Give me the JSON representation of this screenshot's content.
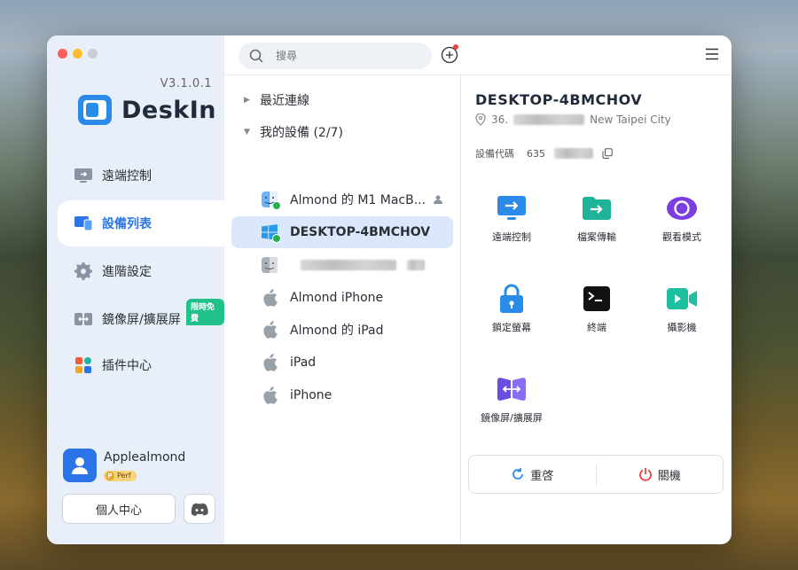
{
  "app": {
    "version": "V3.1.0.1",
    "name": "DeskIn"
  },
  "sidebar": {
    "items": [
      {
        "label": "遠端控制",
        "icon": "remote-control-icon"
      },
      {
        "label": "設備列表",
        "icon": "device-list-icon",
        "active": true
      },
      {
        "label": "進階設定",
        "icon": "gear-icon"
      },
      {
        "label": "鏡像屏/擴展屏",
        "icon": "mirror-screen-icon",
        "badge": "限時免費"
      },
      {
        "label": "插件中心",
        "icon": "plugin-grid-icon"
      }
    ],
    "user": {
      "name": "Applealmond",
      "plan_badge": "Perf",
      "plan_letter": "P"
    },
    "profile_button": "個人中心"
  },
  "topbar": {
    "search_placeholder": "搜尋"
  },
  "device_list": {
    "recent_group": "最近連線",
    "my_devices_group": "我的設備 (2/7)",
    "devices": [
      {
        "name": "Almond 的 M1 MacB...",
        "os": "mac-finder",
        "online": true
      },
      {
        "name": "DESKTOP-4BMCHOV",
        "os": "windows",
        "online": true,
        "selected": true
      },
      {
        "name": "",
        "os": "mac-finder",
        "online": false
      },
      {
        "name": "Almond iPhone",
        "os": "apple"
      },
      {
        "name": "Almond 的 iPad",
        "os": "apple"
      },
      {
        "name": "iPad",
        "os": "apple"
      },
      {
        "name": "iPhone",
        "os": "apple"
      }
    ]
  },
  "detail": {
    "title": "DESKTOP-4BMCHOV",
    "ip_prefix": "36.",
    "city": "New Taipei City",
    "code_label": "設備代碼",
    "code_prefix": "635",
    "tools": [
      {
        "label": "遠端控制",
        "icon": "remote-control-icon",
        "color": "#2a8be8"
      },
      {
        "label": "檔案傳輸",
        "icon": "file-transfer-icon",
        "color": "#1fb39a"
      },
      {
        "label": "觀看模式",
        "icon": "eye-icon",
        "color": "#7b3ee0"
      },
      {
        "label": "鎖定螢幕",
        "icon": "lock-icon",
        "color": "#2a8be8"
      },
      {
        "label": "終端",
        "icon": "terminal-icon",
        "color": "#111111"
      },
      {
        "label": "攝影機",
        "icon": "camera-icon",
        "color": "#1fc0a0"
      },
      {
        "label": "鏡像屏/擴展屏",
        "icon": "mirror-screen-icon",
        "color": "#6b4ee0"
      }
    ],
    "restart_label": "重啓",
    "shutdown_label": "關機"
  }
}
